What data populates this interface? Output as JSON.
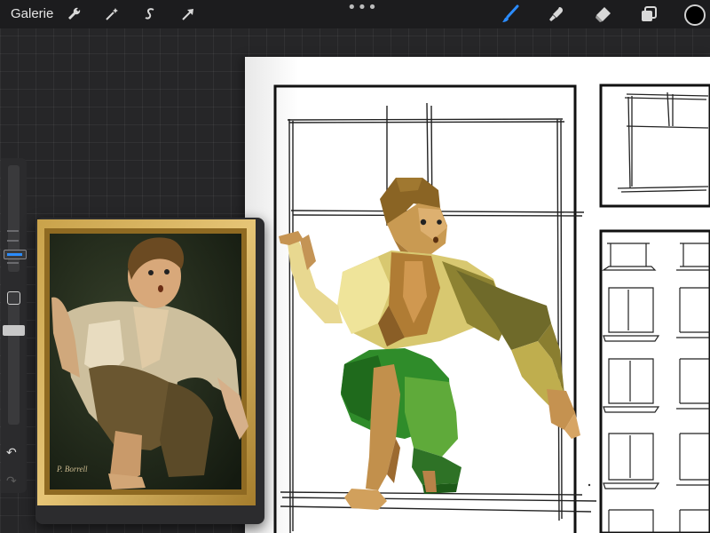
{
  "toolbar": {
    "gallery_label": "Galerie",
    "left_tools": [
      {
        "name": "actions",
        "icon": "wrench-icon"
      },
      {
        "name": "adjustments",
        "icon": "magic-wand-icon"
      },
      {
        "name": "selection",
        "icon": "selection-s-icon"
      },
      {
        "name": "transform",
        "icon": "arrow-cursor-icon"
      }
    ],
    "more_icon": "more-dots-icon",
    "right_tools": [
      {
        "name": "brush",
        "icon": "brush-icon",
        "active": true
      },
      {
        "name": "smudge",
        "icon": "smudge-icon"
      },
      {
        "name": "eraser",
        "icon": "eraser-icon"
      },
      {
        "name": "layers",
        "icon": "layers-icon"
      }
    ],
    "active_color": "#000000",
    "accent_color": "#2b8cff"
  },
  "sidebar": {
    "undo_icon": "undo-icon",
    "redo_icon": "redo-icon",
    "modify_icon": "square-icon"
  },
  "reference": {
    "signature": "P. Borrell"
  }
}
